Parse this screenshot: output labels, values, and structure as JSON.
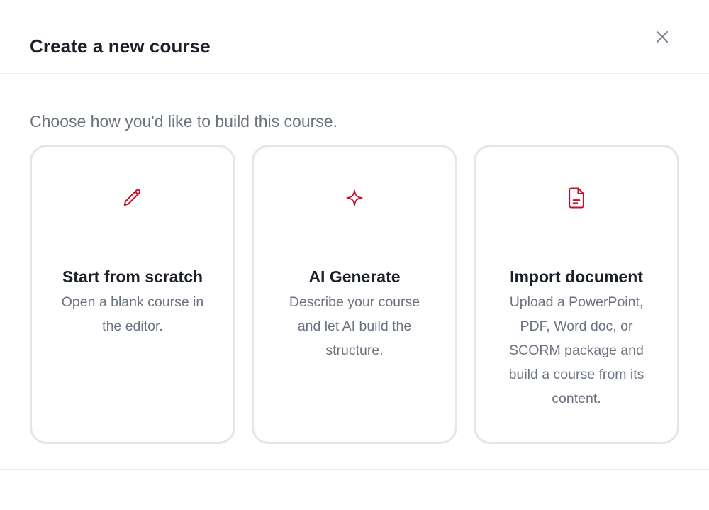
{
  "modal": {
    "title": "Create a new course",
    "close_icon": "close-icon"
  },
  "subtitle": "Choose how you'd like to build this course.",
  "accent_color": "#c8102e",
  "options": [
    {
      "icon": "pencil-icon",
      "title": "Start from scratch",
      "description": "Open a blank course in the editor."
    },
    {
      "icon": "sparkle-icon",
      "title": "AI Generate",
      "description": "Describe your course and let AI build the structure."
    },
    {
      "icon": "document-icon",
      "title": "Import document",
      "description": "Upload a PowerPoint, PDF, Word doc, or SCORM package and build a course from its content."
    }
  ]
}
